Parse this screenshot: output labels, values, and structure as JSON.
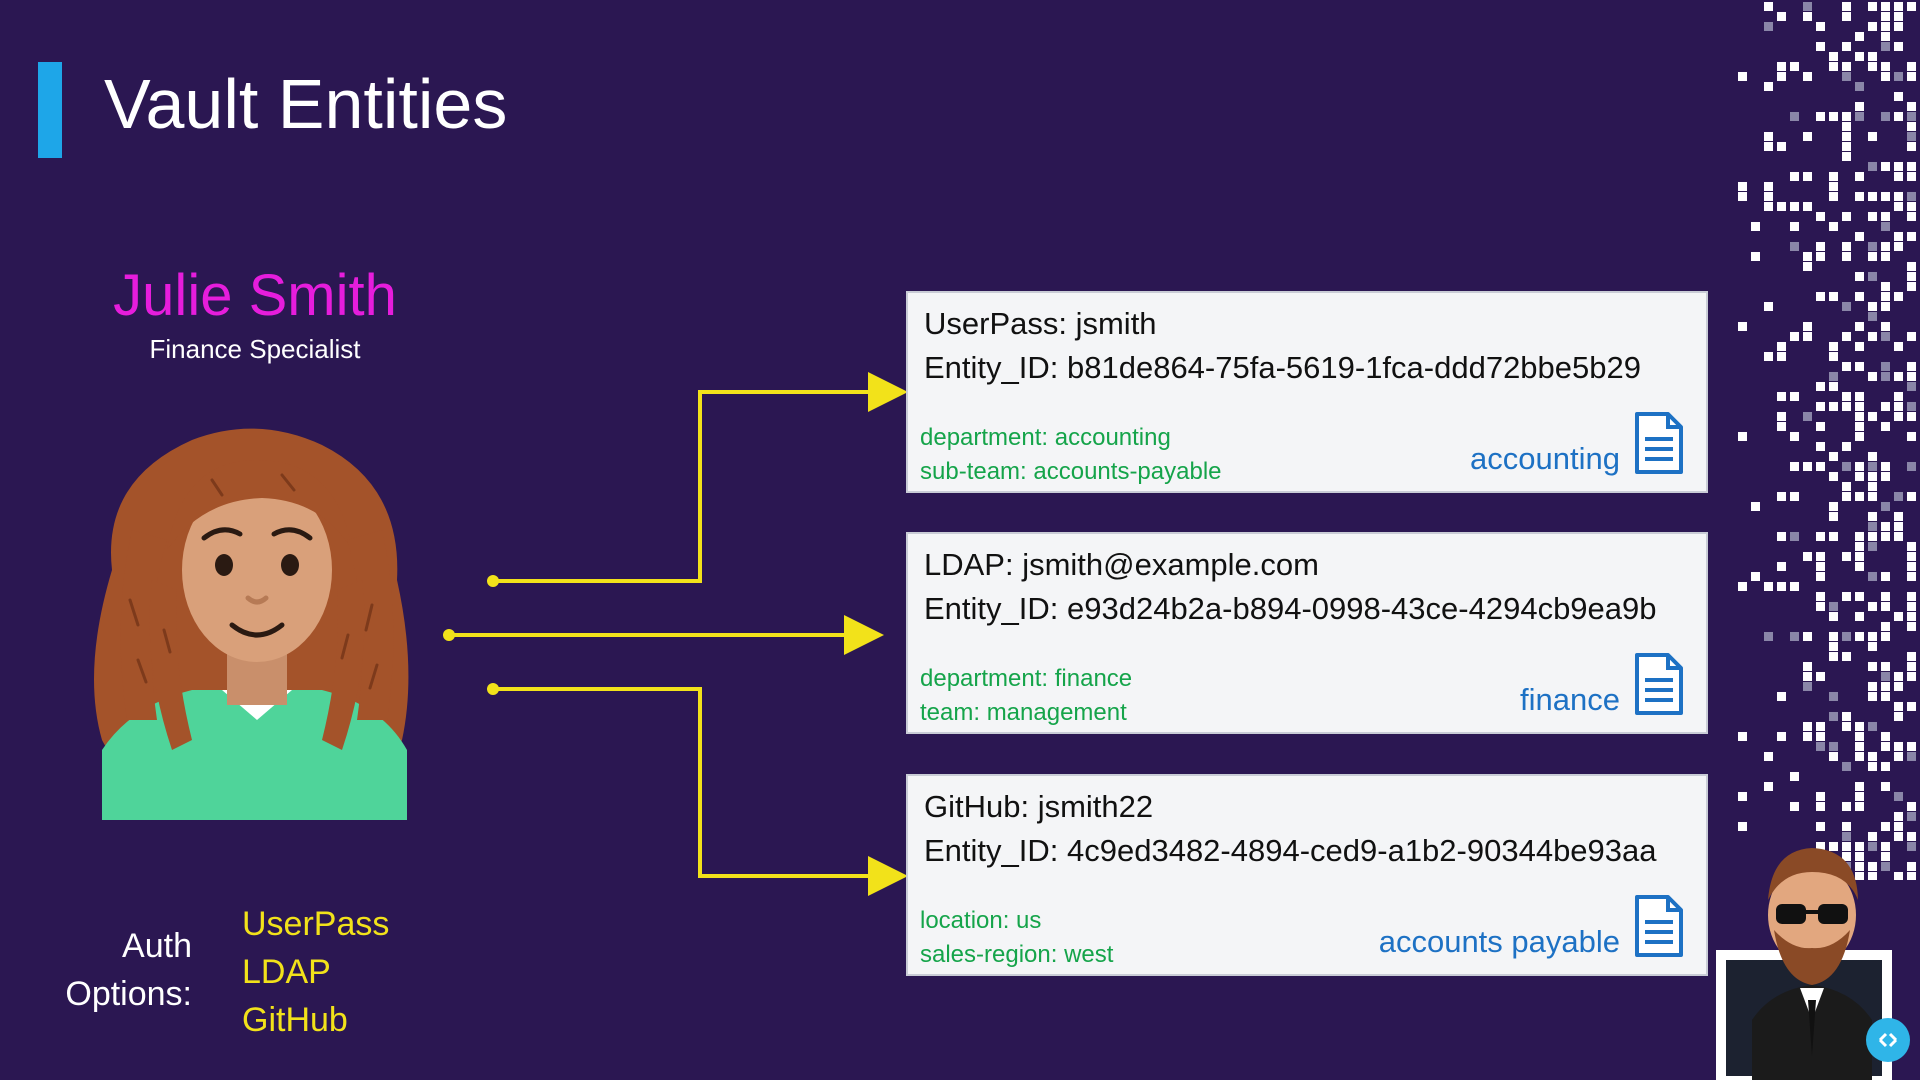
{
  "title": "Vault Entities",
  "person": {
    "name": "Julie Smith",
    "role": "Finance Specialist"
  },
  "auth": {
    "label": "Auth Options:",
    "options": [
      "UserPass",
      "LDAP",
      "GitHub"
    ]
  },
  "entities": [
    {
      "login": "UserPass: jsmith",
      "entity_id": "Entity_ID: b81de864-75fa-5619-1fca-ddd72bbe5b29",
      "meta": [
        "department: accounting",
        "sub-team: accounts-payable"
      ],
      "policy": "accounting"
    },
    {
      "login": "LDAP: jsmith@example.com",
      "entity_id": "Entity_ID: e93d24b2a-b894-0998-43ce-4294cb9ea9b",
      "meta": [
        "department: finance",
        "team: management"
      ],
      "policy": "finance"
    },
    {
      "login": "GitHub: jsmith22",
      "entity_id": "Entity_ID: 4c9ed3482-4894-ced9-a1b2-90344be93aa",
      "meta": [
        "location: us",
        "sales-region: west"
      ],
      "policy": "accounts payable"
    }
  ],
  "colors": {
    "background": "#2b1752",
    "accent_bar": "#1ea6e8",
    "name": "#e61ddc",
    "connector": "#f2e21a",
    "meta": "#15a44a",
    "policy": "#1d71c4"
  }
}
